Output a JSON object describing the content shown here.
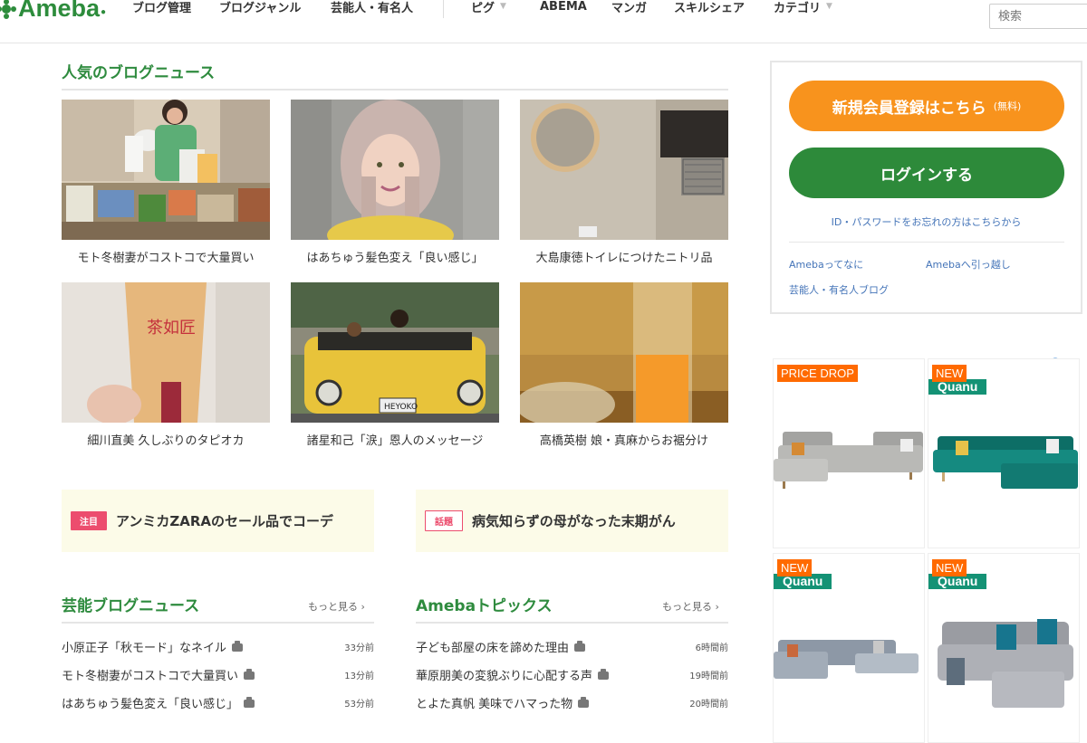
{
  "header": {
    "logo_text": "Ameba",
    "nav": [
      {
        "label": "ブログ管理"
      },
      {
        "label": "ブログジャンル"
      },
      {
        "label": "芸能人・有名人"
      },
      {
        "label": "ピグ"
      },
      {
        "label": "ABEMA"
      },
      {
        "label": "マンガ"
      },
      {
        "label": "スキルシェア"
      },
      {
        "label": "カテゴリ"
      }
    ],
    "search_placeholder": "検索"
  },
  "popular": {
    "title": "人気のブログニュース",
    "items": [
      {
        "caption": "モト冬樹妻がコストコで大量買い"
      },
      {
        "caption": "はあちゅう髪色変え「良い感じ」"
      },
      {
        "caption": "大島康徳トイレにつけたニトリ品"
      },
      {
        "caption": "細川直美 久しぶりのタピオカ"
      },
      {
        "caption": "諸星和己「涙」恩人のメッセージ"
      },
      {
        "caption": "高橋英樹 娘・真麻からお裾分け"
      }
    ]
  },
  "pickups": [
    {
      "badge": "注目",
      "text": "アンミカZARAのセール品でコーデ"
    },
    {
      "badge": "話題",
      "text": "病気知らずの母がなった末期がん"
    }
  ],
  "geino": {
    "title": "芸能ブログニュース",
    "more": "もっと見る",
    "rows": [
      {
        "title": "小原正子「秋モード」なネイル",
        "time": "33分前"
      },
      {
        "title": "モト冬樹妻がコストコで大量買い",
        "time": "13分前"
      },
      {
        "title": "はあちゅう髪色変え「良い感じ」",
        "time": "53分前"
      }
    ]
  },
  "topics": {
    "title": "Amebaトピックス",
    "more": "もっと見る",
    "rows": [
      {
        "title": "子ども部屋の床を諦めた理由",
        "time": "6時間前"
      },
      {
        "title": "華原朋美の変貌ぶりに心配する声",
        "time": "19時間前"
      },
      {
        "title": "とよた真帆 美味でハマった物",
        "time": "20時間前"
      }
    ]
  },
  "sidebar": {
    "register_label": "新規会員登録はこちら",
    "register_note": "(無料)",
    "login_label": "ログインする",
    "forgot_label": "ID・パスワードをお忘れの方はこちらから",
    "links": [
      {
        "label": "Amebaってなに"
      },
      {
        "label": "Amebaへ引っ越し"
      },
      {
        "label": "芸能人・有名人ブログ"
      }
    ]
  },
  "ads": [
    {
      "label": "PRICE DROP",
      "brand": ""
    },
    {
      "label": "NEW",
      "brand": "Quanu"
    },
    {
      "label": "NEW",
      "brand": "Quanu"
    },
    {
      "label": "NEW",
      "brand": "Quanu"
    }
  ],
  "colors": {
    "brand_green": "#2e8b3e",
    "register_orange": "#f8931d",
    "login_green": "#2d8a3a",
    "badge_pink": "#ec4d6e",
    "link_blue": "#4474b8"
  }
}
